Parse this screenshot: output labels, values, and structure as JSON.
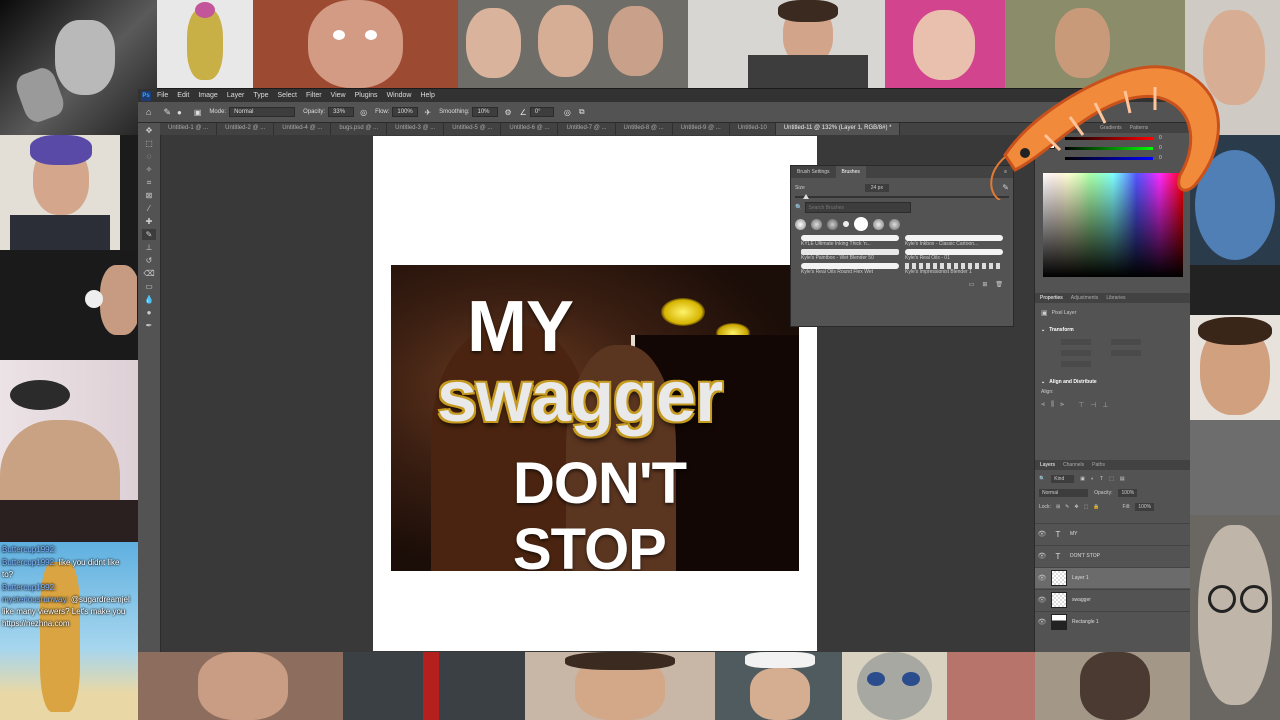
{
  "photoshop": {
    "menu": [
      "File",
      "Edit",
      "Image",
      "Layer",
      "Type",
      "Select",
      "Filter",
      "View",
      "Plugins",
      "Window",
      "Help"
    ],
    "options_bar": {
      "mode_label": "Mode:",
      "mode_value": "Normal",
      "opacity_label": "Opacity:",
      "opacity_value": "33%",
      "flow_label": "Flow:",
      "flow_value": "100%",
      "smoothing_label": "Smoothing:",
      "smoothing_value": "10%",
      "angle_value": "0°"
    },
    "tabs": [
      "Untitled-1 @ ...",
      "Untitled-2 @ ...",
      "Untitled-4 @ ...",
      "bugs.psd @ ...",
      "Untitled-3 @ ...",
      "Untitled-5 @ ...",
      "Untitled-6 @ ...",
      "Untitled-7 @ ...",
      "Untitled-8 @ ...",
      "Untitled-9 @ ...",
      "Untitled-10",
      "Untitled-11 @ 132% (Layer 1, RGB/8#) *"
    ],
    "meme": {
      "line1": "MY",
      "line2": "swagger",
      "line3": "DON'T STOP"
    },
    "brush_panel": {
      "tab_settings": "Brush Settings",
      "tab_brushes": "Brushes",
      "size_label": "Size",
      "size_value": "24 px",
      "search_placeholder": "Search Brushes",
      "brushes": [
        "KYLE Ultimate Inking Thick 'n...",
        "Kyle's Inkbox - Classic Cartoon...",
        "Kyle's Paintbox - Wet Blender 50",
        "Kyle's Real Oils - 01",
        "Kyle's Real Oils Round Flex Wet",
        "Kyle's Impressionist Blender 1"
      ]
    },
    "color_panel": {
      "tab_gradients": "Gradients",
      "tab_patterns": "Patterns",
      "r": "0",
      "g": "0",
      "b": "0"
    },
    "properties": {
      "tabs": [
        "Properties",
        "Adjustments",
        "Libraries"
      ],
      "kind": "Pixel Layer",
      "transform": "Transform",
      "align": "Align and Distribute",
      "align_label": "Align:"
    },
    "layers_panel": {
      "tabs": [
        "Layers",
        "Channels",
        "Paths"
      ],
      "kind_label": "Kind",
      "blend": "Normal",
      "opacity_label": "Opacity:",
      "opacity_value": "100%",
      "lock_label": "Lock:",
      "fill_label": "Fill:",
      "fill_value": "100%",
      "layers": [
        "MY",
        "DON'T STOP",
        "Layer 1",
        "swagger",
        "Rectangle 1"
      ]
    }
  },
  "chat": {
    "lines": [
      {
        "user": "Buttercup1992:",
        "text": ""
      },
      {
        "user": "Buttercup1992:",
        "text": " like you didnt like"
      },
      {
        "user": "",
        "text": "to?"
      },
      {
        "user": "Buttercup1992:",
        "text": ""
      },
      {
        "user": "mysteriousrunway:",
        "text": " @sugardreamjel"
      },
      {
        "user": "",
        "text": "like many viewers? Let's make you"
      },
      {
        "user": "",
        "text": "https://nezhna.com"
      }
    ]
  }
}
